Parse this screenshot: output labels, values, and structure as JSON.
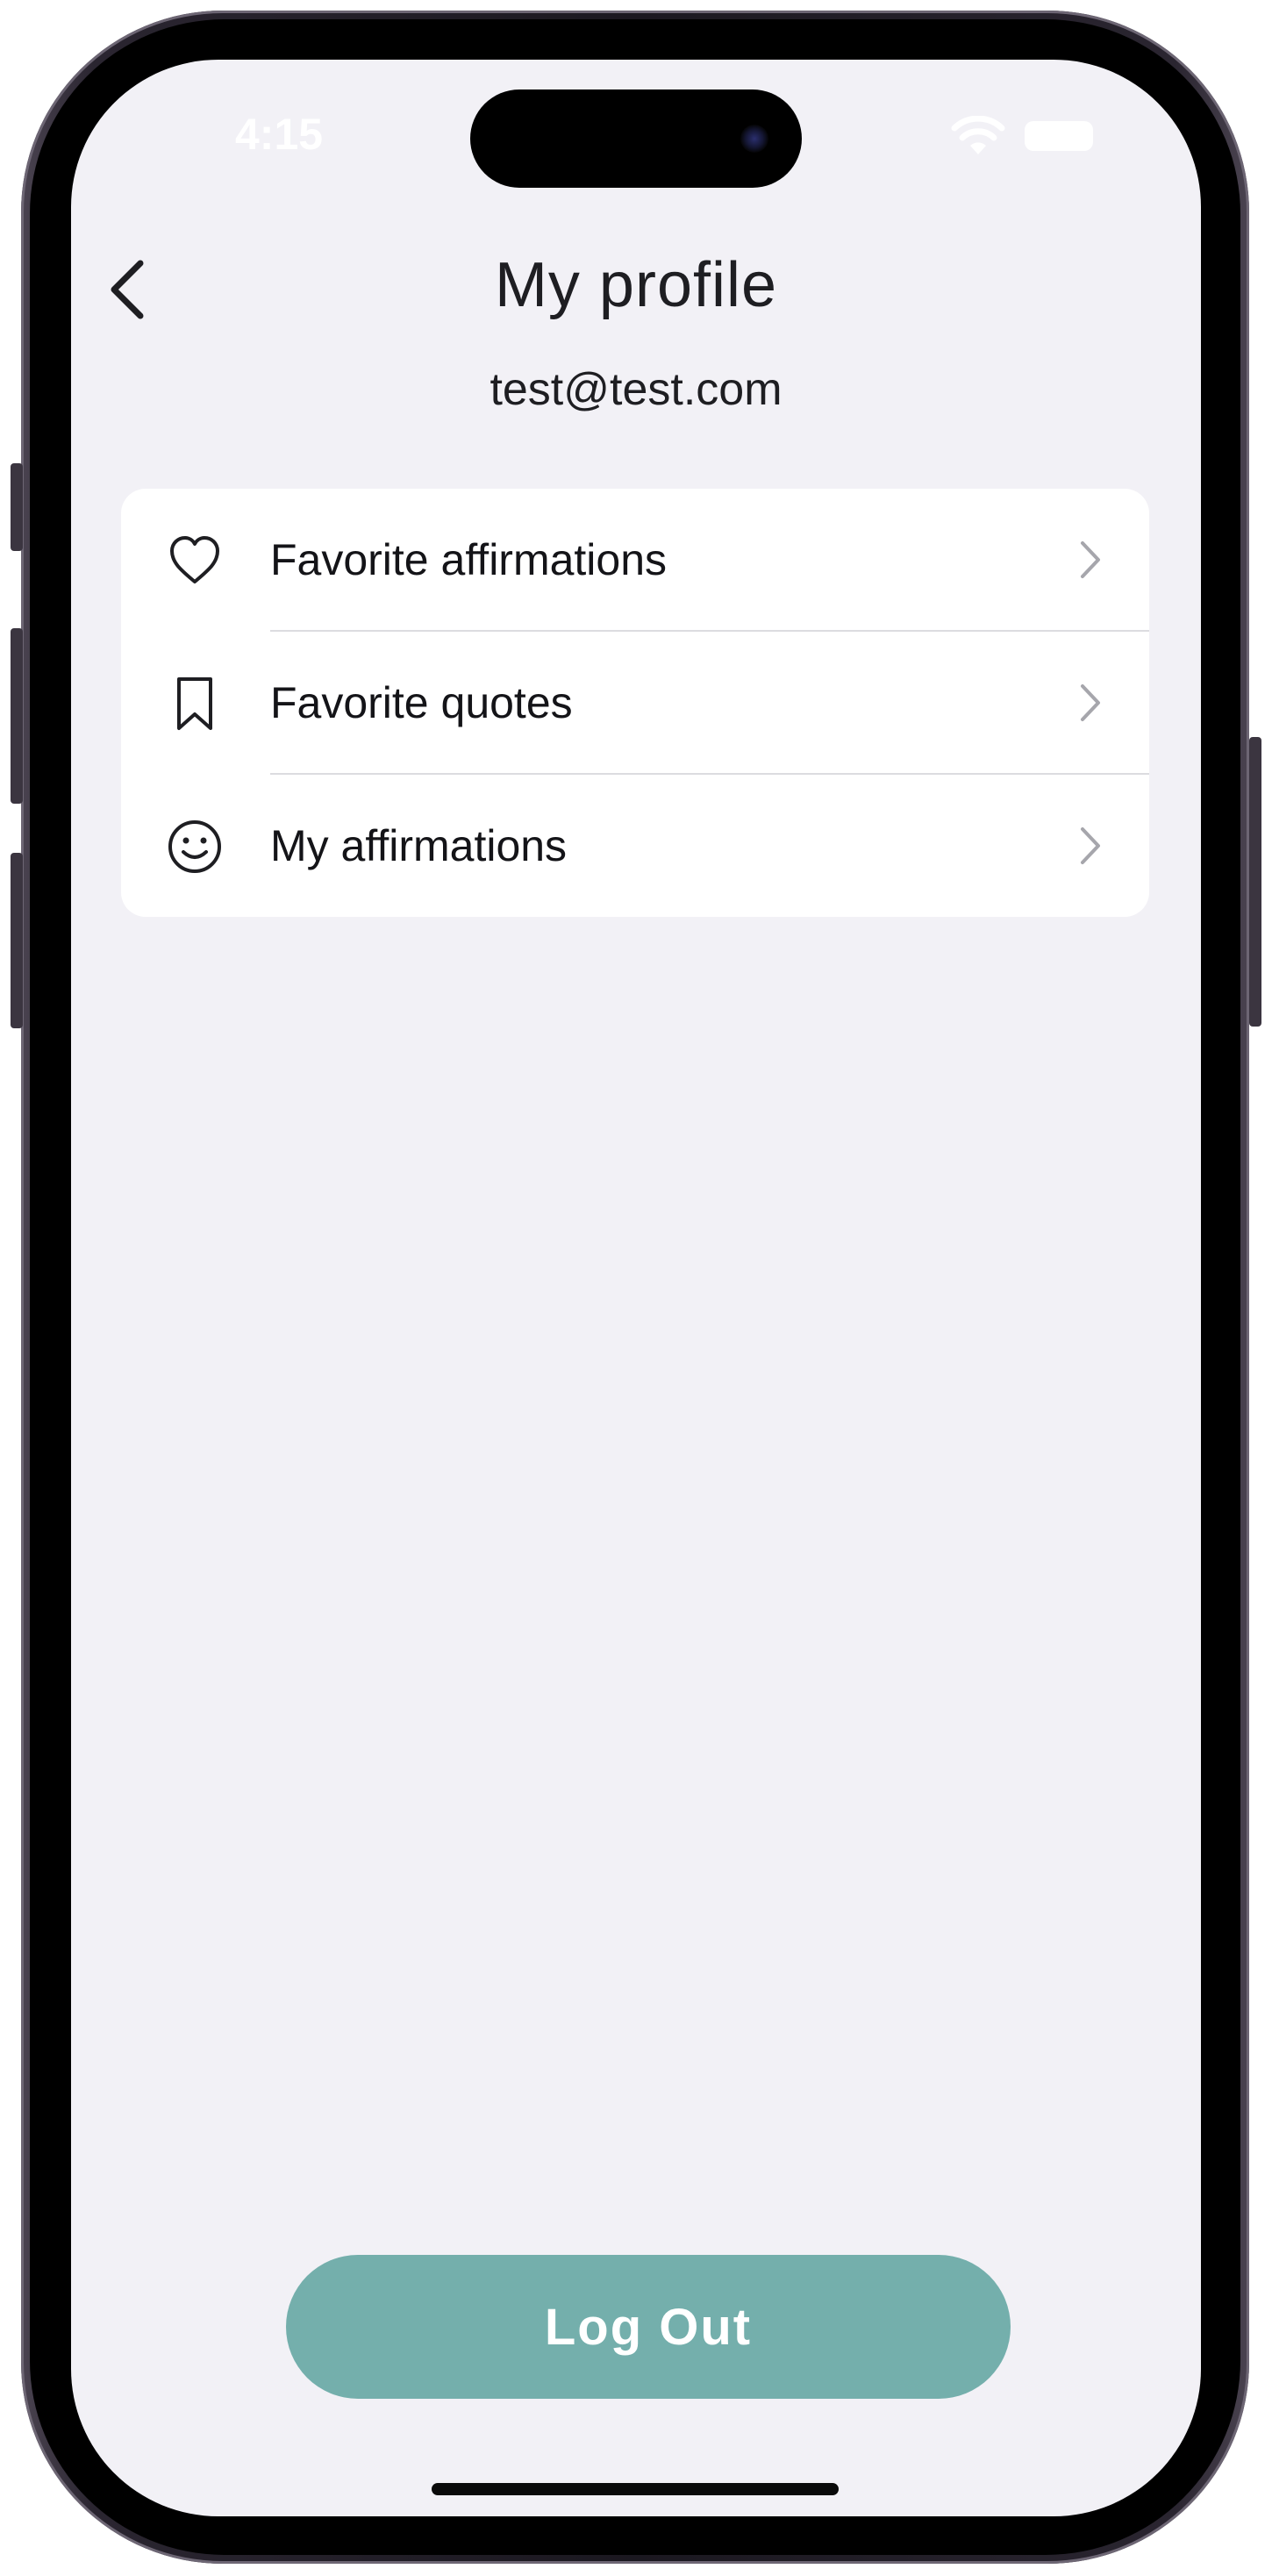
{
  "status_bar": {
    "time": "4:15",
    "wifi_icon": "wifi-icon",
    "battery_icon": "battery-icon"
  },
  "header": {
    "back_icon": "chevron-left-icon",
    "title": "My profile",
    "email": "test@test.com"
  },
  "menu": {
    "items": [
      {
        "label": "Favorite affirmations",
        "icon": "heart-icon"
      },
      {
        "label": "Favorite quotes",
        "icon": "bookmark-icon"
      },
      {
        "label": "My affirmations",
        "icon": "smiley-icon"
      }
    ],
    "chevron_icon": "chevron-right-icon"
  },
  "footer": {
    "logout_label": "Log Out"
  },
  "colors": {
    "background": "#f2f1f6",
    "card": "#ffffff",
    "accent": "#74afac",
    "text": "#1e1e22"
  }
}
